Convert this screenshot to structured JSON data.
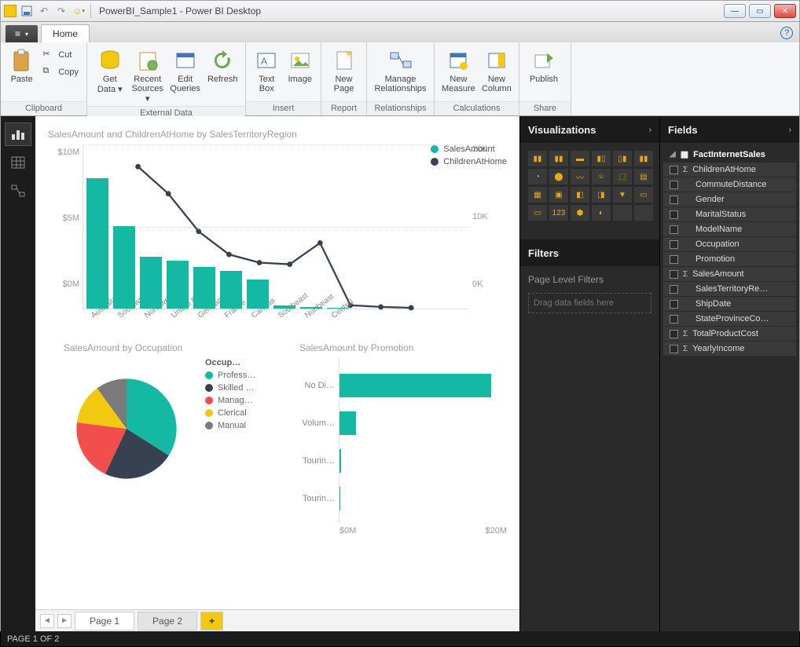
{
  "title": "PowerBI_Sample1 - Power BI Desktop",
  "tabs": {
    "file": "",
    "home": "Home"
  },
  "ribbon": {
    "clipboard": {
      "label": "Clipboard",
      "paste": "Paste",
      "cut": "Cut",
      "copy": "Copy"
    },
    "extdata": {
      "label": "External Data",
      "getdata": "Get Data ▾",
      "recent": "Recent Sources ▾",
      "edit": "Edit Queries",
      "refresh": "Refresh"
    },
    "insert": {
      "label": "Insert",
      "textbox": "Text Box",
      "image": "Image"
    },
    "report": {
      "label": "Report",
      "newpage": "New Page"
    },
    "rel": {
      "label": "Relationships",
      "manage": "Manage Relationships"
    },
    "calc": {
      "label": "Calculations",
      "measure": "New Measure",
      "column": "New Column"
    },
    "share": {
      "label": "Share",
      "publish": "Publish"
    }
  },
  "panes": {
    "visualizations": "Visualizations",
    "filters": "Filters",
    "filters_sub": "Page Level Filters",
    "filters_drop": "Drag data fields here",
    "fields": "Fields",
    "table": "FactInternetSales",
    "field_items": [
      {
        "name": "ChildrenAtHome",
        "sigma": true
      },
      {
        "name": "CommuteDistance",
        "sigma": false
      },
      {
        "name": "Gender",
        "sigma": false
      },
      {
        "name": "MaritalStatus",
        "sigma": false
      },
      {
        "name": "ModelName",
        "sigma": false
      },
      {
        "name": "Occupation",
        "sigma": false
      },
      {
        "name": "Promotion",
        "sigma": false
      },
      {
        "name": "SalesAmount",
        "sigma": true
      },
      {
        "name": "SalesTerritoryRe…",
        "sigma": false
      },
      {
        "name": "ShipDate",
        "sigma": false
      },
      {
        "name": "StateProvinceCo…",
        "sigma": false
      },
      {
        "name": "TotalProductCost",
        "sigma": true
      },
      {
        "name": "YearlyIncome",
        "sigma": true
      }
    ]
  },
  "pages": {
    "p1": "Page 1",
    "p2": "Page 2",
    "add": "+"
  },
  "status": "PAGE 1 OF 2",
  "chart_data": [
    {
      "type": "bar+line",
      "title": "SalesAmount and ChildrenAtHome by SalesTerritoryRegion",
      "categories": [
        "Australia",
        "Southwest",
        "Northwest",
        "United Kin…",
        "Germany",
        "France",
        "Canada",
        "Southeast",
        "Northeast",
        "Central"
      ],
      "series": [
        {
          "name": "SalesAmount",
          "kind": "bar",
          "color": "#15b8a3",
          "axis": "left",
          "values": [
            9.0,
            5.7,
            3.6,
            3.3,
            2.9,
            2.6,
            2.0,
            0.2,
            0.1,
            0.05
          ]
        },
        {
          "name": "ChildrenAtHome",
          "kind": "line",
          "color": "#374151",
          "axis": "right",
          "values": [
            17300,
            14000,
            9400,
            6600,
            5600,
            5400,
            8000,
            400,
            200,
            100
          ]
        }
      ],
      "yleft": {
        "ticks": [
          "$10M",
          "$5M",
          "$0M"
        ],
        "min": 0,
        "max": 10
      },
      "yright": {
        "ticks": [
          "20K",
          "10K",
          "0K"
        ],
        "min": 0,
        "max": 20000
      }
    },
    {
      "type": "pie",
      "title": "SalesAmount by Occupation",
      "legend_header": "Occup…",
      "slices": [
        {
          "label": "Profess…",
          "color": "#15b8a3",
          "value": 34
        },
        {
          "label": "Skilled …",
          "color": "#374151",
          "value": 23
        },
        {
          "label": "Manag…",
          "color": "#f24e4e",
          "value": 20
        },
        {
          "label": "Clerical",
          "color": "#f2c811",
          "value": 13
        },
        {
          "label": "Manual",
          "color": "#7a7a7a",
          "value": 10
        }
      ]
    },
    {
      "type": "bar-horizontal",
      "title": "SalesAmount by Promotion",
      "categories": [
        "No Di…",
        "Volum…",
        "Tourin…",
        "Tourin…"
      ],
      "values": [
        27,
        3,
        0.3,
        0.2
      ],
      "xticks": [
        "$0M",
        "$20M"
      ],
      "xmax": 28
    }
  ]
}
